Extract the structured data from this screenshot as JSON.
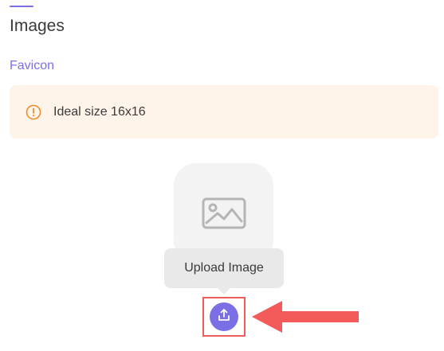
{
  "section": {
    "title": "Images"
  },
  "favicon": {
    "label": "Favicon",
    "alert_text": "Ideal size 16x16"
  },
  "upload": {
    "tooltip": "Upload Image"
  },
  "icons": {
    "alert": "info-circle-icon",
    "placeholder": "image-icon",
    "upload": "upload-icon",
    "annotation": "red-arrow"
  },
  "colors": {
    "accent": "#7b6fe6",
    "alert_bg": "#fff4ea",
    "alert_icon": "#f08c2c",
    "highlight": "#f35a5a"
  }
}
